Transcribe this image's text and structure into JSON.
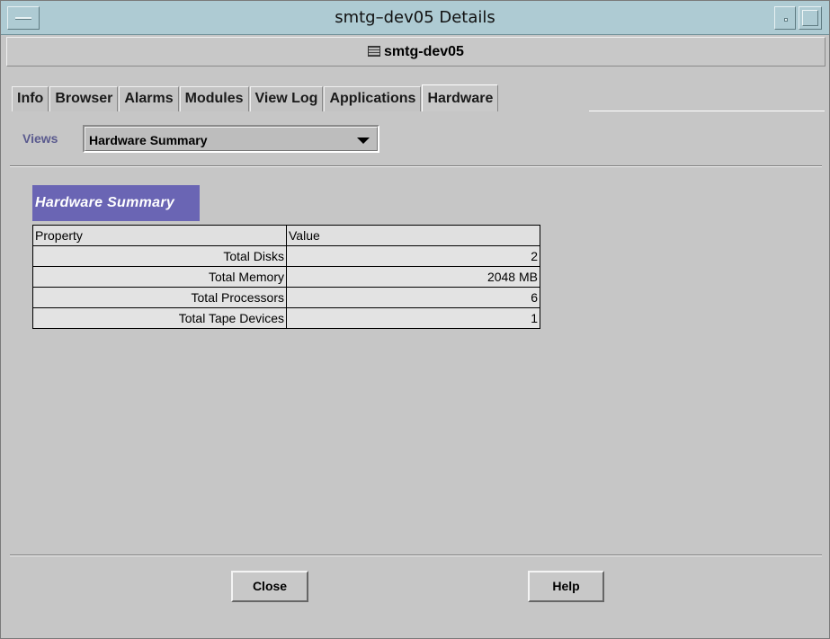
{
  "window": {
    "title": "smtg–dev05 Details",
    "host_label": "smtg-dev05"
  },
  "tabs": [
    {
      "label": "Info",
      "active": false
    },
    {
      "label": "Browser",
      "active": false
    },
    {
      "label": "Alarms",
      "active": false
    },
    {
      "label": "Modules",
      "active": false
    },
    {
      "label": "View Log",
      "active": false
    },
    {
      "label": "Applications",
      "active": false
    },
    {
      "label": "Hardware",
      "active": true
    }
  ],
  "views": {
    "label": "Views",
    "selected": "Hardware Summary"
  },
  "summary": {
    "title": "Hardware Summary",
    "columns": [
      "Property",
      "Value"
    ],
    "rows": [
      {
        "property": "Total Disks",
        "value": "2"
      },
      {
        "property": "Total Memory",
        "value": "2048 MB"
      },
      {
        "property": "Total Processors",
        "value": "6"
      },
      {
        "property": "Total Tape Devices",
        "value": "1"
      }
    ]
  },
  "buttons": {
    "close": "Close",
    "help": "Help"
  },
  "colors": {
    "titlebar": "#aecbd3",
    "summary_header": "#6a65b4",
    "views_label": "#5a5a8e"
  }
}
